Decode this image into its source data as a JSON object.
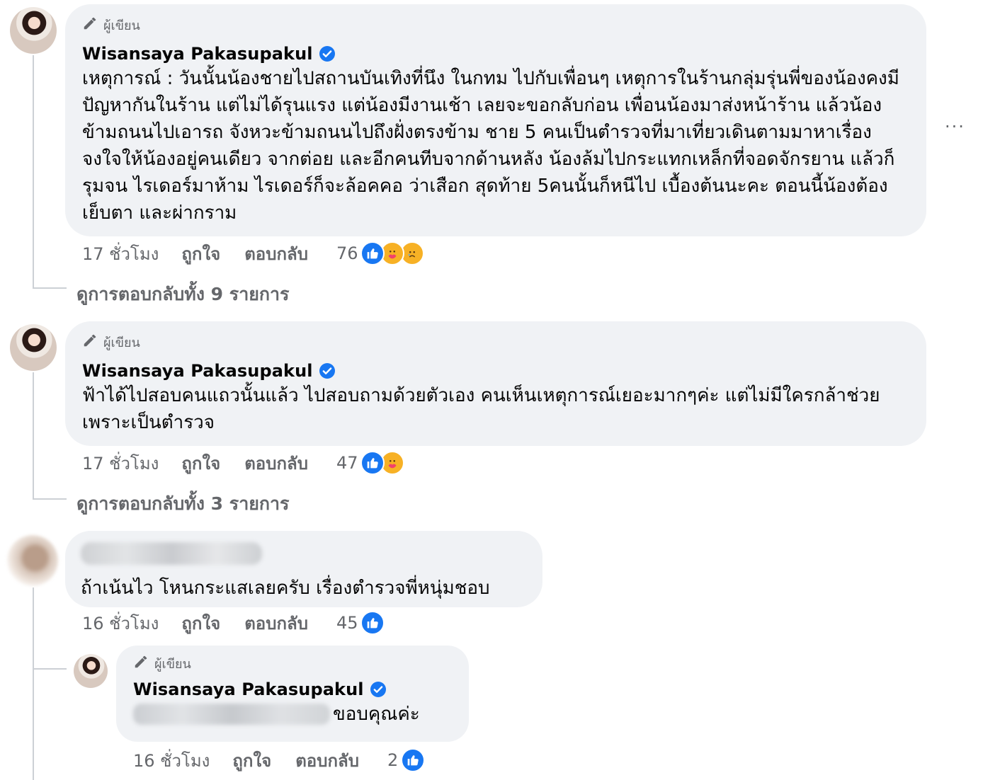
{
  "author_label": "ผู้เขียน",
  "icons": {
    "author": "pencil-icon",
    "verified": "verified-badge-icon",
    "more": "more-options-icon",
    "like_reaction": "like-reaction-icon",
    "care_reaction": "care-reaction-icon",
    "sad_reaction": "sad-reaction-icon"
  },
  "colors": {
    "bubble": "#f0f2f5",
    "secondary_text": "#65676b",
    "like_blue": "#1877f2",
    "verified_blue": "#1877f2"
  },
  "more_options": "...",
  "comments": [
    {
      "name": "Wisansaya Pakasupakul",
      "verified": true,
      "text": "เหตุการณ์ : วันนั้นน้องชายไปสถานบันเทิงที่นึง ในกทม ไปกับเพื่อนๆ เหตุการในร้านกลุ่มรุ่นพี่ของน้องคงมีปัญหากันในร้าน แต่ไม่ได้รุนแรง แต่น้องมีงานเช้า เลยจะขอกลับก่อน เพื่อนน้องมาส่งหน้าร้าน แล้วน้องข้ามถนนไปเอารถ จังหวะข้ามถนนไปถึงฝั่งตรงข้าม ชาย 5 คนเป็นตำรวจที่มาเที่ยวเดินตามมาหาเรื่อง จงใจให้น้องอยู่คนเดียว จากต่อย และอีกคนทีบจากด้านหลัง น้องล้มไปกระแทกเหล็กที่จอดจักรยาน แล้วก็รุมจน ไรเดอร์มาห้าม ไรเดอร์ก็จะล้อคคอ ว่าเสือก สุดท้าย 5คนนั้นก็หนีไป เบื้องต้นนะคะ ตอนนี้น้องต้องเย็บตา และผ่ากราม",
      "time": "17 ชั่วโมง",
      "like": "ถูกใจ",
      "reply": "ตอบกลับ",
      "reaction_count": "76",
      "reactions": [
        "like",
        "care",
        "sad"
      ],
      "view_replies": "ดูการตอบกลับทั้ง 9 รายการ"
    },
    {
      "name": "Wisansaya Pakasupakul",
      "verified": true,
      "text": "ฟ้าได้ไปสอบคนแถวนั้นแล้ว ไปสอบถามด้วยตัวเอง คนเห็นเหตุการณ์เยอะมากๆค่ะ แต่ไม่มีใครกล้าช่วย เพราะเป็นตำรวจ",
      "time": "17 ชั่วโมง",
      "like": "ถูกใจ",
      "reply": "ตอบกลับ",
      "reaction_count": "47",
      "reactions": [
        "like",
        "care"
      ],
      "view_replies": "ดูการตอบกลับทั้ง 3 รายการ"
    },
    {
      "name": "",
      "text": "ถ้าเน้นไว โหนกระแสเลยครับ เรื่องตำรวจพี่หนุ่มชอบ",
      "time": "16 ชั่วโมง",
      "like": "ถูกใจ",
      "reply": "ตอบกลับ",
      "reaction_count": "45",
      "reactions": [
        "like"
      ]
    }
  ],
  "reply": {
    "name": "Wisansaya Pakasupakul",
    "verified": true,
    "text": "ขอบคุณค่ะ",
    "time": "16 ชั่วโมง",
    "like": "ถูกใจ",
    "reply": "ตอบกลับ",
    "reaction_count": "2",
    "reactions": [
      "like"
    ]
  }
}
